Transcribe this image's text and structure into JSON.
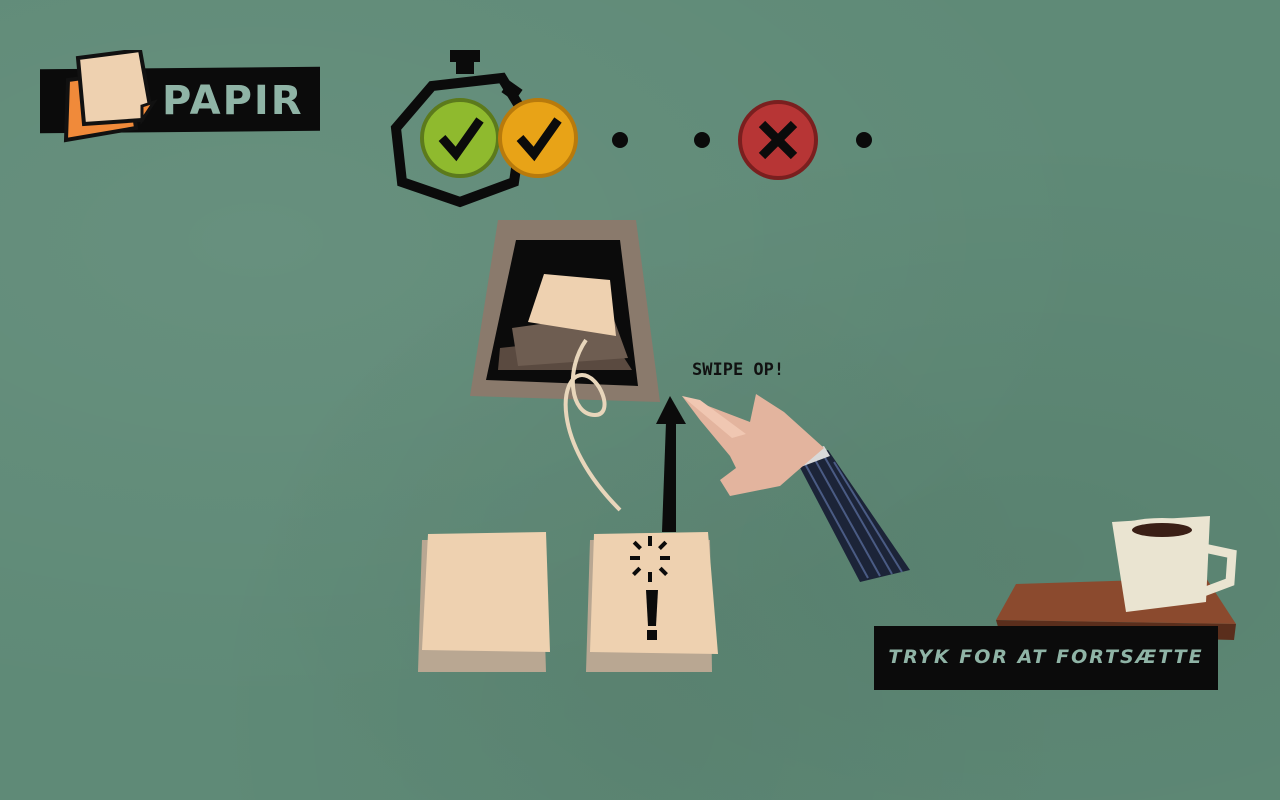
{
  "category": {
    "title": "PAPIR"
  },
  "progress": {
    "results": [
      "correct",
      "correct",
      "pending",
      "pending",
      "wrong",
      "pending"
    ],
    "colors": {
      "correct_green": "#8fba2e",
      "correct_orange": "#e8a317",
      "wrong_red": "#b73535"
    }
  },
  "tutorial": {
    "instruction": "SWIPE OP!"
  },
  "continue_button": {
    "label": "TRYK FOR AT FORTSÆTTE"
  }
}
